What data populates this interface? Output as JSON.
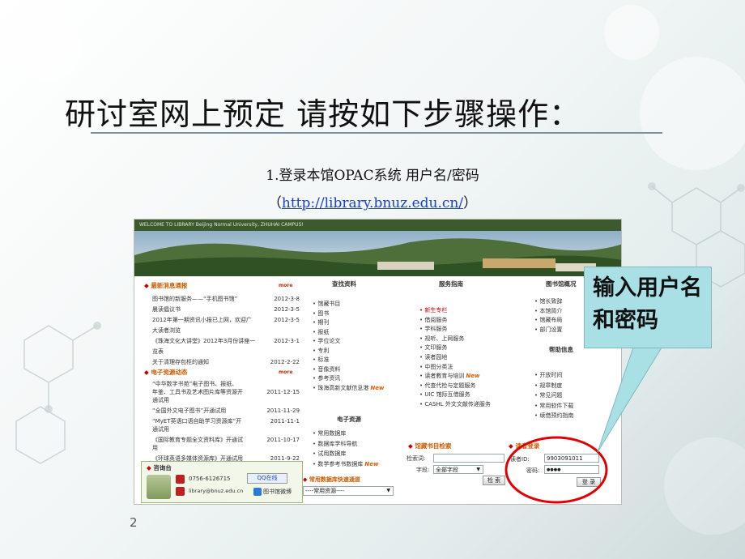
{
  "slide": {
    "title": "研讨室网上预定 请按如下步骤操作：",
    "step": "1.登录本馆OPAC系统 用户名/密码",
    "url_open": "（",
    "url": "http://library.bnuz.edu.cn/",
    "url_close": "）",
    "page_number": "2",
    "callout": "输入用户名和密码"
  },
  "screenshot": {
    "banner_text": "WELCOME TO LIBRARY Beijing Normal University, ZHUHAI CAMPUS!",
    "news": {
      "header": "最新消息通报",
      "more": "more",
      "items": [
        {
          "text": "图书馆的新服务——“手机图书馆”",
          "date": "2012-3-8"
        },
        {
          "text": "晨读倡议书",
          "date": "2012-3-5"
        },
        {
          "text": "2012年第一期资讯小报已上网，欢迎广",
          "date": "2012-3-5"
        },
        {
          "text": "大读者浏览",
          "date": ""
        },
        {
          "text": "《珠海文化大讲堂》2012年3月份讲座一",
          "date": "2012-3-1"
        },
        {
          "text": "览表",
          "date": ""
        },
        {
          "text": "关于清理存包柜的通知",
          "date": "2012-2-22"
        }
      ]
    },
    "eres_news": {
      "header": "电子资源动态",
      "more": "more",
      "items": [
        {
          "text": "“中华数字书苑”电子图书、报纸、",
          "date": ""
        },
        {
          "text": "年鉴、工具书及艺术图片库等资源开",
          "date": "2011-12-15"
        },
        {
          "text": "通试用",
          "date": ""
        },
        {
          "text": "“全国外文电子图书”开通试用",
          "date": "2011-11-29"
        },
        {
          "text": "“MyET英语口语自助学习资源库”开",
          "date": "2011-11-1"
        },
        {
          "text": "通试用",
          "date": ""
        },
        {
          "text": "《国际教育专题全文资料库》开通试",
          "date": "2011-10-17"
        },
        {
          "text": "用",
          "date": ""
        },
        {
          "text": "《环球英语多媒体资源库》开通试用",
          "date": "2011-9-22"
        }
      ]
    },
    "contact": {
      "header": "咨询台",
      "phone": "0756-6126715",
      "email": "library@bnuz.edu.cn",
      "qq": "QQ在线",
      "weibo": "图书馆微博"
    },
    "search_res": {
      "header": "查找资料",
      "items": [
        "馆藏书目",
        "图书",
        "期刊",
        "报纸",
        "学位论文",
        "专利",
        "标准",
        "音像资料",
        "参考资讯",
        "珠海高新文献信息港"
      ]
    },
    "eres": {
      "header": "电子资源",
      "items": [
        "常用数据库",
        "数据库学科导航",
        "试用数据库",
        "数学参考书数据库"
      ],
      "quick_header": "常用数据库快速通道",
      "quick_select": "----常用资源----"
    },
    "services": {
      "header": "服务指南",
      "items": [
        "新生专栏",
        "借阅服务",
        "学科服务",
        "视听、上网服务",
        "文印服务",
        "读者园地",
        "中图分类法",
        "读者教育与培训",
        "代查代检与定题服务",
        "UIC 馆际互借服务",
        "CASHL 外文文献传递服务"
      ]
    },
    "overview": {
      "header": "图书馆概况",
      "items": [
        "馆长致辞",
        "本馆简介",
        "馆藏布局",
        "部门设置"
      ]
    },
    "help": {
      "header": "帮助信息",
      "items": [
        "开放时间",
        "规章制度",
        "常见问题",
        "常用软件下载",
        "续借预约指南"
      ]
    },
    "catalog": {
      "header": "馆藏书目检索",
      "keyword_label": "检索词:",
      "field_label": "字段:",
      "field_value": "全部字段",
      "search_button": "检 索"
    },
    "login": {
      "header": "读者登录",
      "id_label": "读者ID:",
      "id_value": "9903091011",
      "password_label": "密码:",
      "password_value": "●●●●",
      "login_button": "登 录"
    }
  },
  "colors": {
    "accent_green": "#5f8d2c",
    "callout_fill": "#a9e0e6",
    "highlight_circle": "#e00000"
  }
}
